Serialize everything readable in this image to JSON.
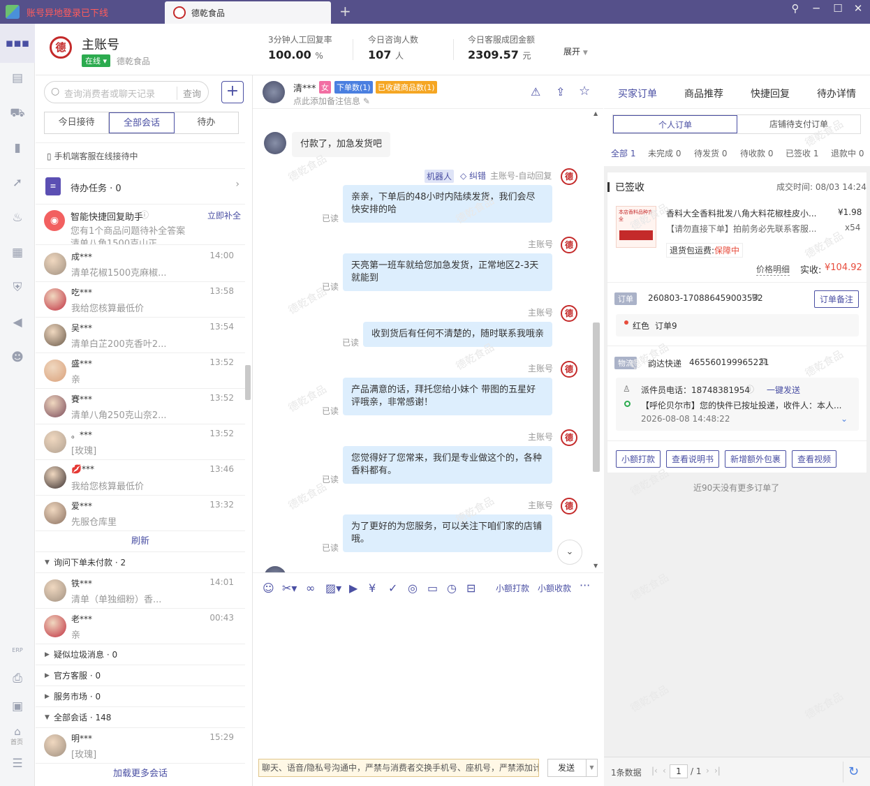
{
  "tabs": {
    "tab1_label": "账号异地登录已下线",
    "tab2_label": "德乾食品",
    "add": "+"
  },
  "window": {
    "pin": "⚲",
    "min": "─",
    "max": "☐",
    "close": "✕"
  },
  "nav": {
    "erp": "ERP",
    "home": "首页"
  },
  "header": {
    "account": "主账号",
    "status": "在线",
    "shop": "德乾食品",
    "logo_text": "德",
    "stats": [
      {
        "label": "3分钟人工回复率",
        "value": "100.00",
        "unit": "%"
      },
      {
        "label": "今日咨询人数",
        "value": "107",
        "unit": "人"
      },
      {
        "label": "今日客服成团金额",
        "value": "2309.57",
        "unit": "元"
      }
    ],
    "expand": "展开"
  },
  "left": {
    "search_placeholder": "查询消费者或聊天记录",
    "search_btn": "查询",
    "segs": [
      "今日接待",
      "全部会话",
      "待办"
    ],
    "mobile_note": "手机端客服在线接待中",
    "todo": "待办任务 · 0",
    "assistant_title": "智能快捷回复助手",
    "assistant_link": "立即补全",
    "assistant_desc": "您有1个商品问题待补全答案",
    "assistant_cut": "清单八角1500克山正...",
    "convs": [
      {
        "name": "成***",
        "time": "14:00",
        "msg": "清单花椒1500克麻椒..."
      },
      {
        "name": "吃***",
        "time": "13:58",
        "msg": "我给您核算最低价"
      },
      {
        "name": "吴***",
        "time": "13:54",
        "msg": "清单白芷200克香叶2..."
      },
      {
        "name": "盛***",
        "time": "13:52",
        "msg": "亲"
      },
      {
        "name": "賽***",
        "time": "13:52",
        "msg": "清单八角250克山奈2..."
      },
      {
        "name": "。***",
        "time": "13:52",
        "msg": "[玫瑰]"
      },
      {
        "name": "💋***",
        "time": "13:46",
        "msg": "我给您核算最低价"
      },
      {
        "name": "爱***",
        "time": "13:32",
        "msg": "先服仓库里"
      }
    ],
    "refresh": "刷新",
    "group1": "询问下单未付款 · 2",
    "convs2": [
      {
        "name": "铁***",
        "time": "14:01",
        "msg": "清单（单独细粉）香..."
      },
      {
        "name": "老***",
        "time": "00:43",
        "msg": "亲"
      }
    ],
    "groups": [
      "疑似垃圾消息 · 0",
      "官方客服 · 0",
      "服务市场 · 0",
      "全部会话 · 148"
    ],
    "convs3": [
      {
        "name": "明***",
        "time": "15:29",
        "msg": "[玫瑰]"
      }
    ],
    "load_more": "加载更多会话"
  },
  "chat": {
    "name": "清***",
    "gender": "女",
    "badge_order": "下单数(1)",
    "badge_fav": "已收藏商品数(1)",
    "remark": "点此添加备注信息",
    "customer_msg": "付款了，加急发货吧",
    "robot_tag": "机器人",
    "correct": "纠错",
    "robot_sender": "主账号-自动回复",
    "sender": "主账号",
    "read": "已读",
    "msgs": [
      "亲亲，下单后的48小时内陆续发货，我们会尽快安排的哈",
      "天亮第一班车就给您加急发货，正常地区2-3天就能到",
      "收到货后有任何不清楚的，随时联系我哦亲",
      "产品满意的话，拜托您给小妹个 带图的五星好评哦亲，非常感谢！",
      "您觉得好了您常来，我们是专业做这个的，各种香料都有。",
      "为了更好的为您服务，可以关注下咱们家的店铺哦。"
    ],
    "tool_small_pay": "小额打款",
    "tool_small_collect": "小额收款",
    "notice": "聊天、语音/隐私号沟通中，严禁与消费者交换手机号、座机号，严禁添加计",
    "send": "发送"
  },
  "right": {
    "tabs": [
      "买家订单",
      "商品推荐",
      "快捷回复",
      "待办详情"
    ],
    "subtabs": [
      "个人订单",
      "店铺待支付订单"
    ],
    "status_filters": [
      "全部 1",
      "未完成 0",
      "待发货 0",
      "待收款 0",
      "已签收 1",
      "退款中 0"
    ],
    "order_status": "已签收",
    "deal_time": "成交时间: 08/03 14:24",
    "product_title": "香料大全香料批发八角大料花椒桂皮小...",
    "product_price": "¥1.98",
    "product_sub": "【请勿直接下单】拍前务必先联系客服...",
    "product_qty": "x54",
    "product_img_text": "本店香料品种齐全",
    "return_label": "退货包运费:",
    "return_status": "保障中",
    "price_detail": "价格明细",
    "paid_label": "实收:",
    "paid": "¥104.92",
    "order_tag": "订单",
    "order_no": "260803-170886459003532",
    "order_note_btn": "订单备注",
    "flag": "红色",
    "flag_text": "订单9",
    "logistics_tag": "物流",
    "carrier": "韵达快递",
    "tracking": "465560199965221",
    "courier_phone": "派件员电话：18748381954",
    "one_click": "一键发送",
    "track_msg": "【呼伦贝尔市】您的快件已按址投递，收件人：本人...",
    "track_time": "2026-08-08 14:48:22",
    "actions": [
      "小额打款",
      "查看说明书",
      "新增额外包裹",
      "查看视频"
    ],
    "no_more": "近90天没有更多订单了",
    "total": "1条数据",
    "page": "1",
    "pages": "/ 1"
  },
  "watermark": "德乾食品",
  "colors": {
    "accent": "#4a4fa3",
    "online": "#2cab4f",
    "price": "#e74c3c",
    "tab_bg": "#55508a"
  }
}
